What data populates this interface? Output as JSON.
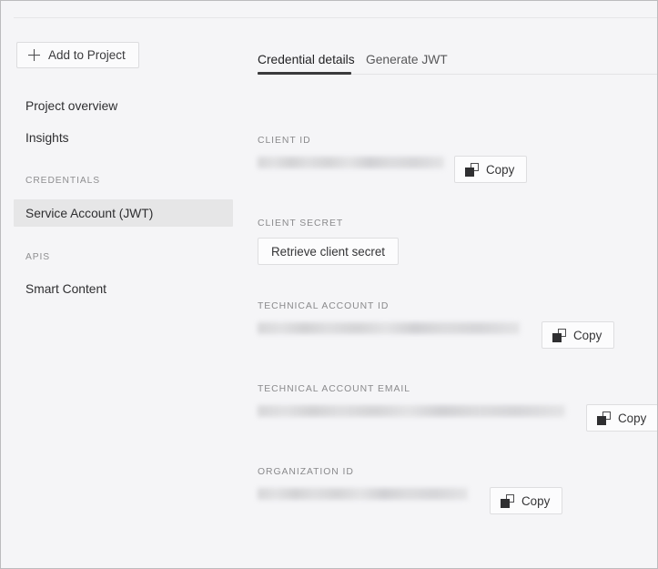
{
  "sidebar": {
    "add_button": {
      "label": "Add to Project",
      "icon": "plus-icon"
    },
    "items": [
      {
        "label": "Project overview",
        "selected": false
      },
      {
        "label": "Insights",
        "selected": false
      }
    ],
    "sections": [
      {
        "heading": "CREDENTIALS",
        "items": [
          {
            "label": "Service Account (JWT)",
            "selected": true
          }
        ]
      },
      {
        "heading": "APIS",
        "items": [
          {
            "label": "Smart Content",
            "selected": false
          }
        ]
      }
    ]
  },
  "main": {
    "tabs": [
      {
        "label": "Credential details",
        "active": true
      },
      {
        "label": "Generate JWT",
        "active": false
      }
    ],
    "fields": [
      {
        "label": "CLIENT ID",
        "value": "",
        "value_redacted": true,
        "action": {
          "type": "copy",
          "label": "Copy",
          "icon": "copy-icon"
        }
      },
      {
        "label": "CLIENT SECRET",
        "value": "",
        "value_redacted": false,
        "action": {
          "type": "button",
          "label": "Retrieve client secret"
        }
      },
      {
        "label": "TECHNICAL ACCOUNT ID",
        "value": "",
        "value_redacted": true,
        "action": {
          "type": "copy",
          "label": "Copy",
          "icon": "copy-icon"
        }
      },
      {
        "label": "TECHNICAL ACCOUNT EMAIL",
        "value": "",
        "value_redacted": true,
        "action": {
          "type": "copy",
          "label": "Copy",
          "icon": "copy-icon"
        }
      },
      {
        "label": "ORGANIZATION ID",
        "value": "",
        "value_redacted": true,
        "action": {
          "type": "copy",
          "label": "Copy",
          "icon": "copy-icon"
        }
      }
    ]
  },
  "colors": {
    "background": "#f5f5f7",
    "selected_item": "#e6e6e7",
    "active_tab_underline": "#3a3a3c",
    "label_text": "#8a8a8c",
    "body_text": "#2e2e30",
    "border": "#dedee0"
  }
}
